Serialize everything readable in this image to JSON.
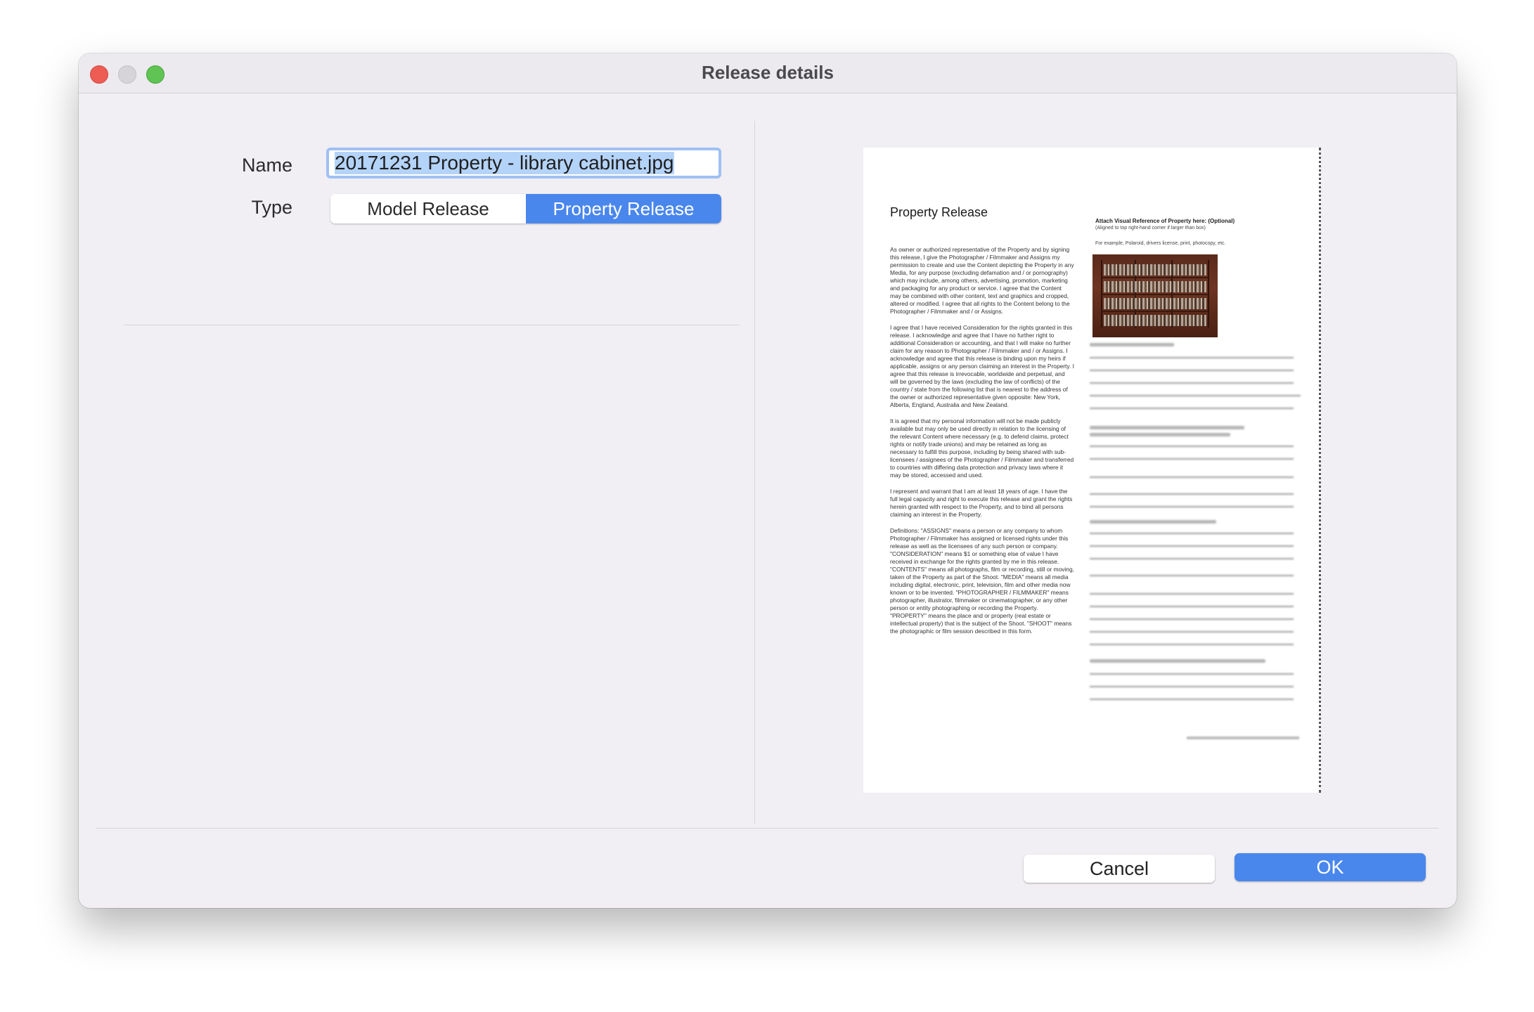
{
  "window": {
    "title": "Release details"
  },
  "form": {
    "name_label": "Name",
    "name_value": "20171231 Property - library cabinet.jpg",
    "type_label": "Type",
    "type_options": [
      "Model Release",
      "Property Release"
    ],
    "type_selected": "Property Release"
  },
  "preview": {
    "doc_title": "Property Release",
    "paragraphs": [
      "As owner or authorized representative of the Property and by signing this release, I give the Photographer / Filmmaker and Assigns my permission to create and use the Content depicting the Property in any Media, for any purpose (excluding defamation and / or pornography) which may include, among others, advertising, promotion, marketing and packaging for any product or service. I agree that the Content may be combined with other content, text and graphics and cropped, altered or modified. I agree that all rights to the Content belong to the Photographer / Filmmaker and / or Assigns.",
      "I agree that I have received Consideration for the rights granted in this release. I acknowledge and agree that I have no further right to additional Consideration or accounting, and that I will make no further claim for any reason to Photographer / Filmmaker and / or Assigns. I acknowledge and agree that this release is binding upon my heirs if applicable, assigns or any person claiming an interest in the Property. I agree that this release is irrevocable, worldwide and perpetual, and will be governed by the laws (excluding the law of conflicts) of the country / state from the following list that is nearest to the address of the owner or authorized representative given opposite: New York, Alberta, England, Australia and New Zealand.",
      "It is agreed that my personal information will not be made publicly available but may only be used directly in relation to the licensing of the relevant Content where necessary (e.g. to defend claims, protect rights or notify trade unions) and may be retained as long as necessary to fulfill this purpose, including by being shared with sub-licensees / assignees of the Photographer / Filmmaker and transferred to countries with differing data protection and privacy laws where it may be stored, accessed and used.",
      "I represent and warrant that I am at least 18 years of age. I have the full legal capacity and right to execute this release and grant the rights herein granted with respect to the Property, and to bind all persons claiming an interest in the Property.",
      "Definitions: \"ASSIGNS\" means a person or any company to whom Photographer / Filmmaker has assigned or licensed rights under this release as well as the licensees of any such person or company. \"CONSIDERATION\" means $1 or something else of value I have received in exchange for the rights granted by me in this release. \"CONTENTS\" means all photographs, film or recording, still or moving, taken of the Property as part of the Shoot. \"MEDIA\" means all media including digital, electronic, print, television, film and other media now known or to be invented. \"PHOTOGRAPHER / FILMMAKER\" means photographer, illustrator, filmmaker or cinematographer, or any other person or entity photographing or recording the Property. \"PROPERTY\" means the place and or property (real estate or intellectual property) that is the subject of the Shoot. \"SHOOT\" means the photographic or film session described in this form."
    ],
    "attach_title": "Attach Visual Reference of Property here: (Optional)",
    "attach_sub": "(Aligned to top right-hand corner if larger than box)",
    "attach_example": "For example, Polaroid, drivers license, print, photocopy, etc."
  },
  "buttons": {
    "cancel": "Cancel",
    "ok": "OK"
  },
  "colors": {
    "accent": "#4a87ec",
    "window_bg": "#f1eff3"
  }
}
